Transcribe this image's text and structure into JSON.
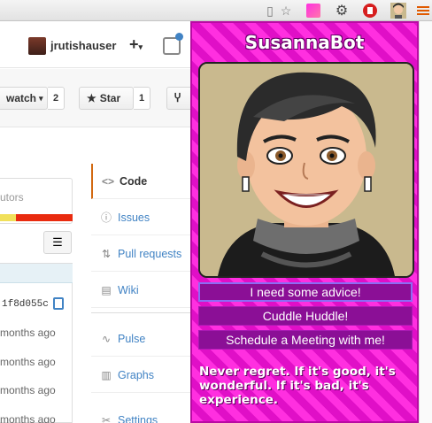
{
  "browser": {
    "icons": [
      "reader-icon",
      "bookmark-star-icon",
      "gradient-extension-icon",
      "gear-extension-icon",
      "stop-extension-icon",
      "bot-avatar-extension-icon",
      "menu-icon"
    ]
  },
  "github": {
    "username": "jrutishauser",
    "plus": "+",
    "watch": {
      "label": "watch",
      "count": "2"
    },
    "star": {
      "label": "Star",
      "count": "1"
    },
    "contributors_fragment": "utors",
    "commit_sha": "1f8d055c",
    "time_ago": [
      "months ago",
      "months ago",
      "months ago",
      "months ago",
      "months ago"
    ],
    "nav": [
      {
        "icon": "<>",
        "label": "Code",
        "active": true
      },
      {
        "icon": "ⓘ",
        "label": "Issues",
        "active": false
      },
      {
        "icon": "⇅",
        "label": "Pull requests",
        "active": false
      },
      {
        "icon": "▤",
        "label": "Wiki",
        "active": false
      },
      {
        "icon": "∿",
        "label": "Pulse",
        "active": false
      },
      {
        "icon": "▥",
        "label": "Graphs",
        "active": false
      },
      {
        "icon": "✂",
        "label": "Settings",
        "active": false
      }
    ]
  },
  "bot": {
    "title": "SusannaBot",
    "buttons": [
      "I need some advice!",
      "Cuddle Huddle!",
      "Schedule a Meeting with me!"
    ],
    "quote": "Never regret. If it's good, it's wonderful. If it's bad, it's experience.",
    "colors": {
      "stripe_a": "#ff2fe0",
      "stripe_b": "#e00fc7",
      "button": "#8b0f96"
    }
  }
}
